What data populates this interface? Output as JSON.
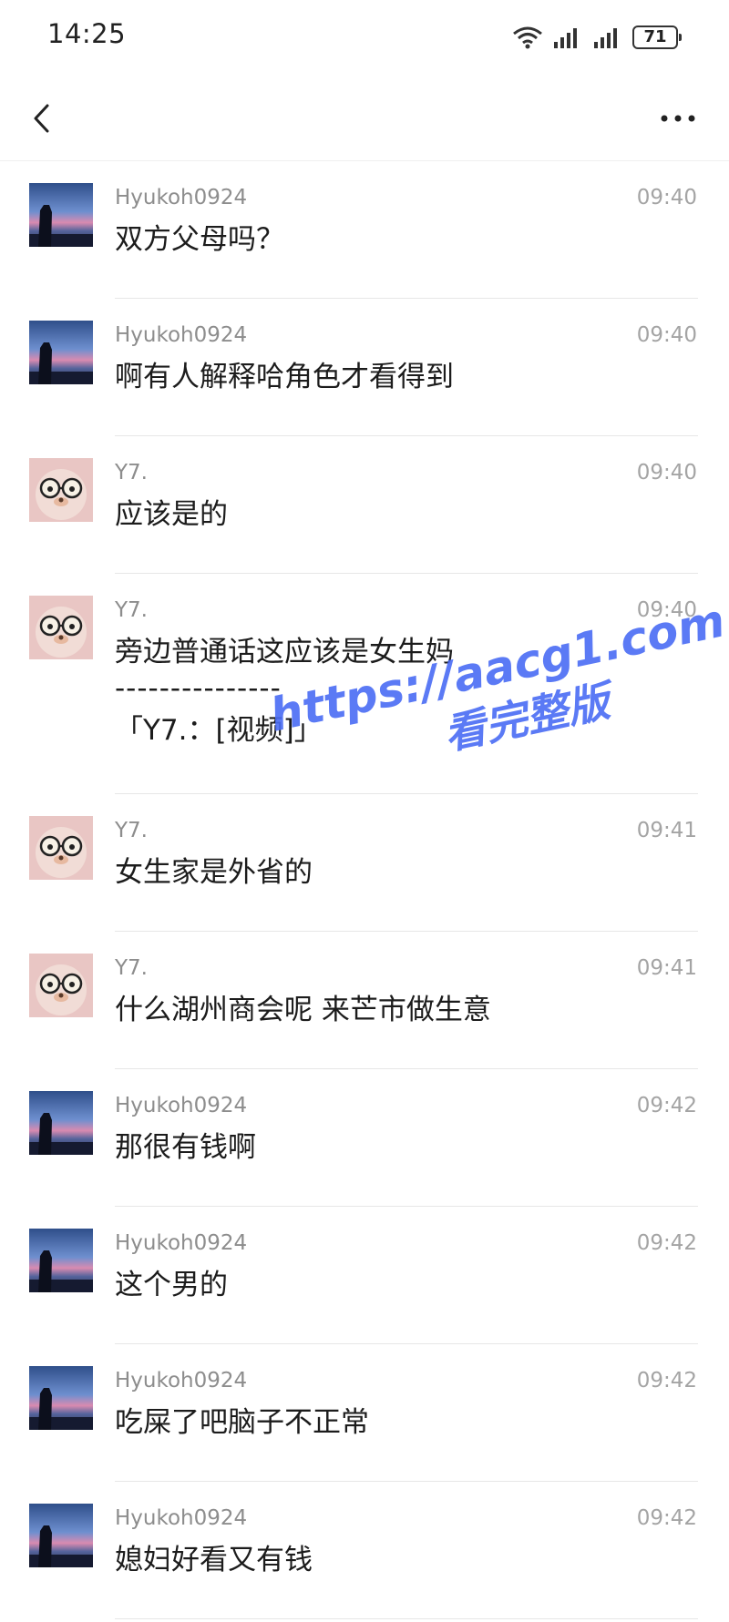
{
  "status_bar": {
    "time": "14:25",
    "battery": "71"
  },
  "navbar": {
    "back_icon": "chevron-left-icon",
    "more_icon": "more-dots-icon"
  },
  "messages": [
    {
      "sender": "Hyukoh0924",
      "time": "09:40",
      "text": "双方父母吗？",
      "avatar": "mountain-avatar"
    },
    {
      "sender": "Hyukoh0924",
      "time": "09:40",
      "text": "啊有人解释哈角色才看得到",
      "avatar": "mountain-avatar"
    },
    {
      "sender": "Y7.",
      "time": "09:40",
      "text": "应该是的",
      "avatar": "bear-avatar"
    },
    {
      "sender": "Y7.",
      "time": "09:40",
      "text": "旁边普通话这应该是女生妈",
      "divider": "---------------",
      "quote": "「Y7.：[视频]」",
      "avatar": "bear-avatar"
    },
    {
      "sender": "Y7.",
      "time": "09:41",
      "text": "女生家是外省的",
      "avatar": "bear-avatar"
    },
    {
      "sender": "Y7.",
      "time": "09:41",
      "text": "什么湖州商会呢 来芒市做生意",
      "avatar": "bear-avatar"
    },
    {
      "sender": "Hyukoh0924",
      "time": "09:42",
      "text": "那很有钱啊",
      "avatar": "mountain-avatar"
    },
    {
      "sender": "Hyukoh0924",
      "time": "09:42",
      "text": "这个男的",
      "avatar": "mountain-avatar"
    },
    {
      "sender": "Hyukoh0924",
      "time": "09:42",
      "text": "吃屎了吧脑子不正常",
      "avatar": "mountain-avatar"
    },
    {
      "sender": "Hyukoh0924",
      "time": "09:42",
      "text": "媳妇好看又有钱",
      "avatar": "mountain-avatar"
    }
  ],
  "watermark": {
    "url": "https://aacg1.com",
    "subtitle": "看完整版"
  }
}
